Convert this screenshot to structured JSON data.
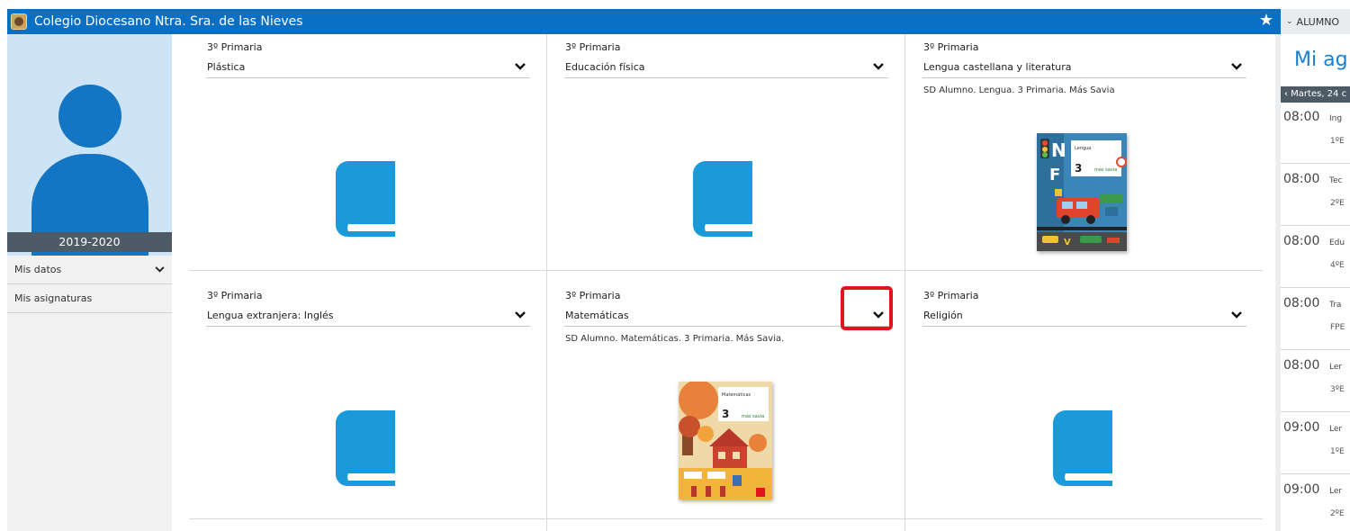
{
  "header": {
    "school_name": "Colegio Diocesano Ntra. Sra. de las Nieves",
    "role_label": "ALUMNO"
  },
  "sidebar": {
    "year": "2019-2020",
    "items": [
      {
        "label": "Mis datos"
      },
      {
        "label": "Mis asignaturas"
      }
    ]
  },
  "subjects": [
    {
      "grade": "3º Primaria",
      "name": "Plástica",
      "description": ""
    },
    {
      "grade": "3º Primaria",
      "name": "Educación física",
      "description": ""
    },
    {
      "grade": "3º Primaria",
      "name": "Lengua castellana y literatura",
      "description": "SD Alumno. Lengua. 3 Primaria. Más Savia"
    },
    {
      "grade": "3º Primaria",
      "name": "Lengua extranjera: Inglés",
      "description": ""
    },
    {
      "grade": "3º Primaria",
      "name": "Matemáticas",
      "description": "SD Alumno. Matemáticas. 3 Primaria. Más Savia."
    },
    {
      "grade": "3º Primaria",
      "name": "Religión",
      "description": ""
    }
  ],
  "agenda": {
    "title": "Mi ag",
    "date_label": "‹ Martes, 24 c",
    "slots": [
      {
        "time": "08:00",
        "subject": "Ing",
        "group": "1ºE"
      },
      {
        "time": "08:00",
        "subject": "Tec",
        "group": "2ºE"
      },
      {
        "time": "08:00",
        "subject": "Edu",
        "group": "4ºE"
      },
      {
        "time": "08:00",
        "subject": "Tra",
        "group": "FPE"
      },
      {
        "time": "08:00",
        "subject": "Ler",
        "group": "3ºE"
      },
      {
        "time": "09:00",
        "subject": "Ler",
        "group": "1ºE"
      },
      {
        "time": "09:00",
        "subject": "Ler",
        "group": "2ºE"
      }
    ]
  },
  "icons": {
    "favorite": "star-icon",
    "dropdown": "chevron-down-icon",
    "book": "book-icon",
    "avatar": "user-avatar-icon"
  },
  "colors": {
    "brand": "#0b6fc3",
    "book_icon": "#1a9ad8",
    "highlight": "#e0141c"
  },
  "cover_text": {
    "lengua_title": "Lengua",
    "matematicas_title": "Matemáticas",
    "grade_digit": "3",
    "publisher": "más savia"
  }
}
